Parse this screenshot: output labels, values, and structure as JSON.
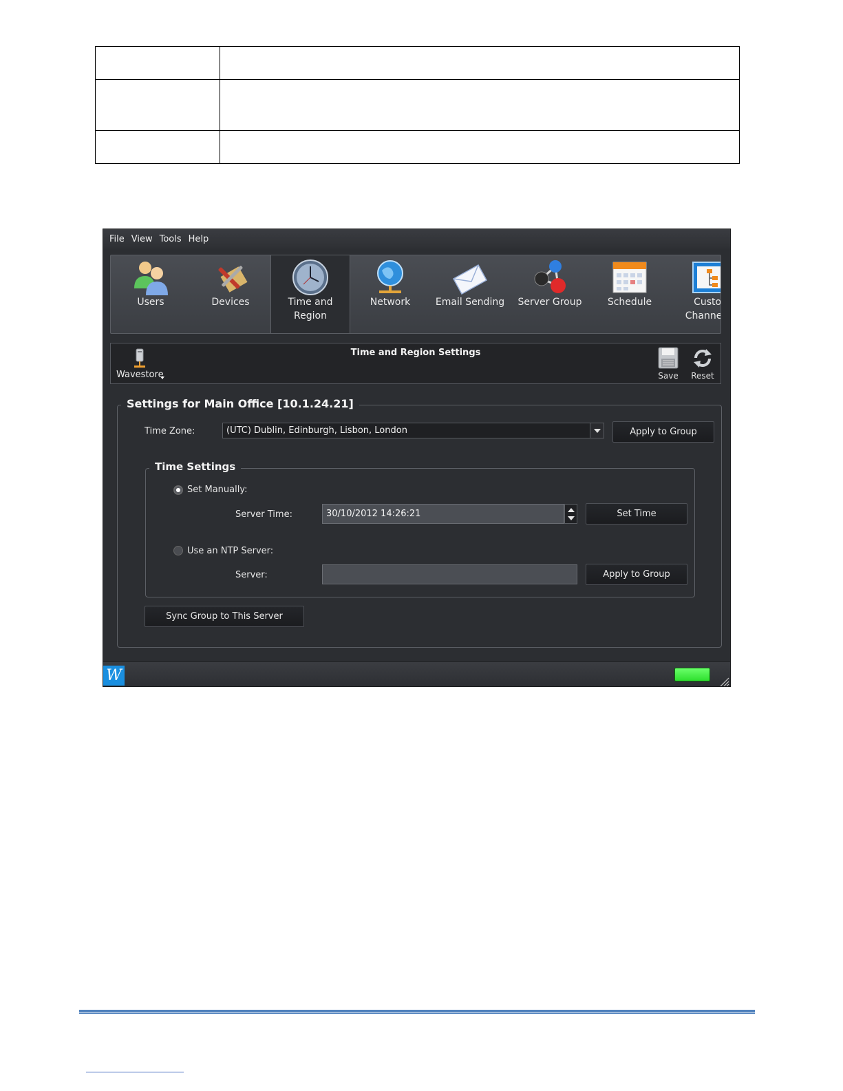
{
  "doc_table": {
    "rows": [
      {
        "col1": "",
        "col2": ""
      },
      {
        "col1": "",
        "col2": ""
      },
      {
        "col1": "",
        "col2": ""
      }
    ]
  },
  "app": {
    "menu": [
      "File",
      "View",
      "Tools",
      "Help"
    ],
    "tabs": [
      {
        "label": "Users",
        "icon": "users-icon"
      },
      {
        "label": "Devices",
        "icon": "devices-icon"
      },
      {
        "label": "Time and\nRegion",
        "icon": "clock-icon",
        "active": true
      },
      {
        "label": "Network",
        "icon": "globe-network-icon"
      },
      {
        "label": "Email Sending",
        "icon": "envelope-icon"
      },
      {
        "label": "Server Group",
        "icon": "server-group-icon"
      },
      {
        "label": "Schedule",
        "icon": "calendar-icon"
      },
      {
        "label": "Custor\nChannel T",
        "icon": "custom-channel-icon"
      }
    ],
    "subtoolbar": {
      "title": "Time and Region Settings",
      "wavestore_label": "Wavestore",
      "save_label": "Save",
      "reset_label": "Reset"
    },
    "settings": {
      "group_title": "Settings for Main Office [10.1.24.21]",
      "timezone_label": "Time Zone:",
      "timezone_value": "(UTC) Dublin, Edinburgh, Lisbon, London",
      "apply_group_label": "Apply to Group",
      "time_settings_title": "Time Settings",
      "set_manually_label": "Set Manually:",
      "server_time_label": "Server Time:",
      "server_time_value": "30/10/2012 14:26:21",
      "set_time_label": "Set Time",
      "ntp_label": "Use an NTP Server:",
      "server_label": "Server:",
      "server_value": "",
      "ntp_apply_label": "Apply to Group",
      "sync_label": "Sync Group to This Server"
    },
    "status": {
      "logo_letter": "W",
      "led_color": "#2ee02e"
    }
  }
}
